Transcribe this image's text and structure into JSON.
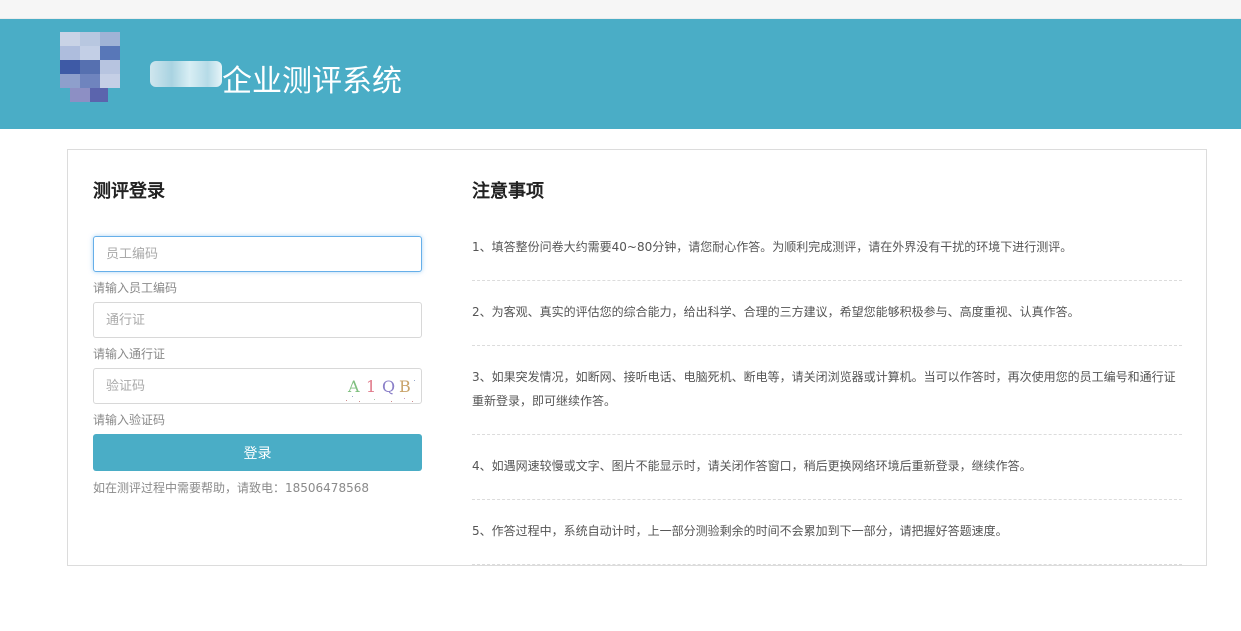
{
  "header": {
    "system_title": "企业测评系统"
  },
  "login": {
    "heading": "测评登录",
    "employee_id": {
      "placeholder": "员工编码",
      "hint": "请输入员工编码"
    },
    "pass": {
      "placeholder": "通行证",
      "hint": "请输入通行证"
    },
    "captcha": {
      "placeholder": "验证码",
      "hint": "请输入验证码",
      "code": [
        "A",
        "1",
        "Q",
        "B"
      ]
    },
    "submit_label": "登录",
    "help_text": "如在测评过程中需要帮助，请致电：18506478568"
  },
  "notes": {
    "heading": "注意事项",
    "items": [
      "1、填答整份问卷大约需要40~80分钟，请您耐心作答。为顺利完成测评，请在外界没有干扰的环境下进行测评。",
      "2、为客观、真实的评估您的综合能力，给出科学、合理的三方建议，希望您能够积极参与、高度重视、认真作答。",
      "3、如果突发情况，如断网、接听电话、电脑死机、断电等，请关闭浏览器或计算机。当可以作答时，再次使用您的员工编号和通行证重新登录，即可继续作答。",
      "4、如遇网速较慢或文字、图片不能显示时，请关闭作答窗口，稍后更换网络环境后重新登录，继续作答。",
      "5、作答过程中，系统自动计时，上一部分测验剩余的时间不会累加到下一部分，请把握好答题速度。"
    ]
  },
  "colors": {
    "accent": "#4aadc6",
    "focus_border": "#66afe9"
  }
}
